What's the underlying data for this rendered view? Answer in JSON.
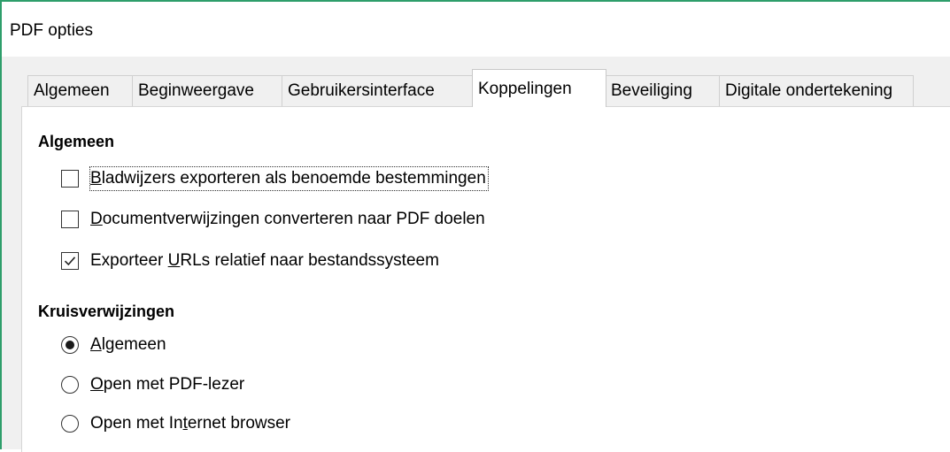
{
  "window": {
    "title": "PDF opties"
  },
  "tabs": [
    {
      "label": "Algemeen",
      "active": false
    },
    {
      "label": "Beginweergave",
      "active": false
    },
    {
      "label": "Gebruikersinterface",
      "active": false
    },
    {
      "label": "Koppelingen",
      "active": true
    },
    {
      "label": "Beveiliging",
      "active": false
    },
    {
      "label": "Digitale ondertekening",
      "active": false
    }
  ],
  "general": {
    "title": "Algemeen",
    "options": [
      {
        "pre": "",
        "mnemonic": "B",
        "post": "ladwijzers exporteren als benoemde bestemmingen",
        "checked": false
      },
      {
        "pre": "",
        "mnemonic": "D",
        "post": "ocumentverwijzingen converteren naar PDF doelen",
        "checked": false
      },
      {
        "pre": "Exporteer ",
        "mnemonic": "U",
        "post": "RLs relatief naar bestandssysteem",
        "checked": true
      }
    ]
  },
  "cross_refs": {
    "title": "Kruisverwijzingen",
    "options": [
      {
        "pre": "",
        "mnemonic": "A",
        "post": "lgemeen",
        "selected": true
      },
      {
        "pre": "",
        "mnemonic": "O",
        "post": "pen met PDF-lezer",
        "selected": false
      },
      {
        "pre": "Open met In",
        "mnemonic": "t",
        "post": "ernet browser",
        "selected": false
      }
    ]
  }
}
